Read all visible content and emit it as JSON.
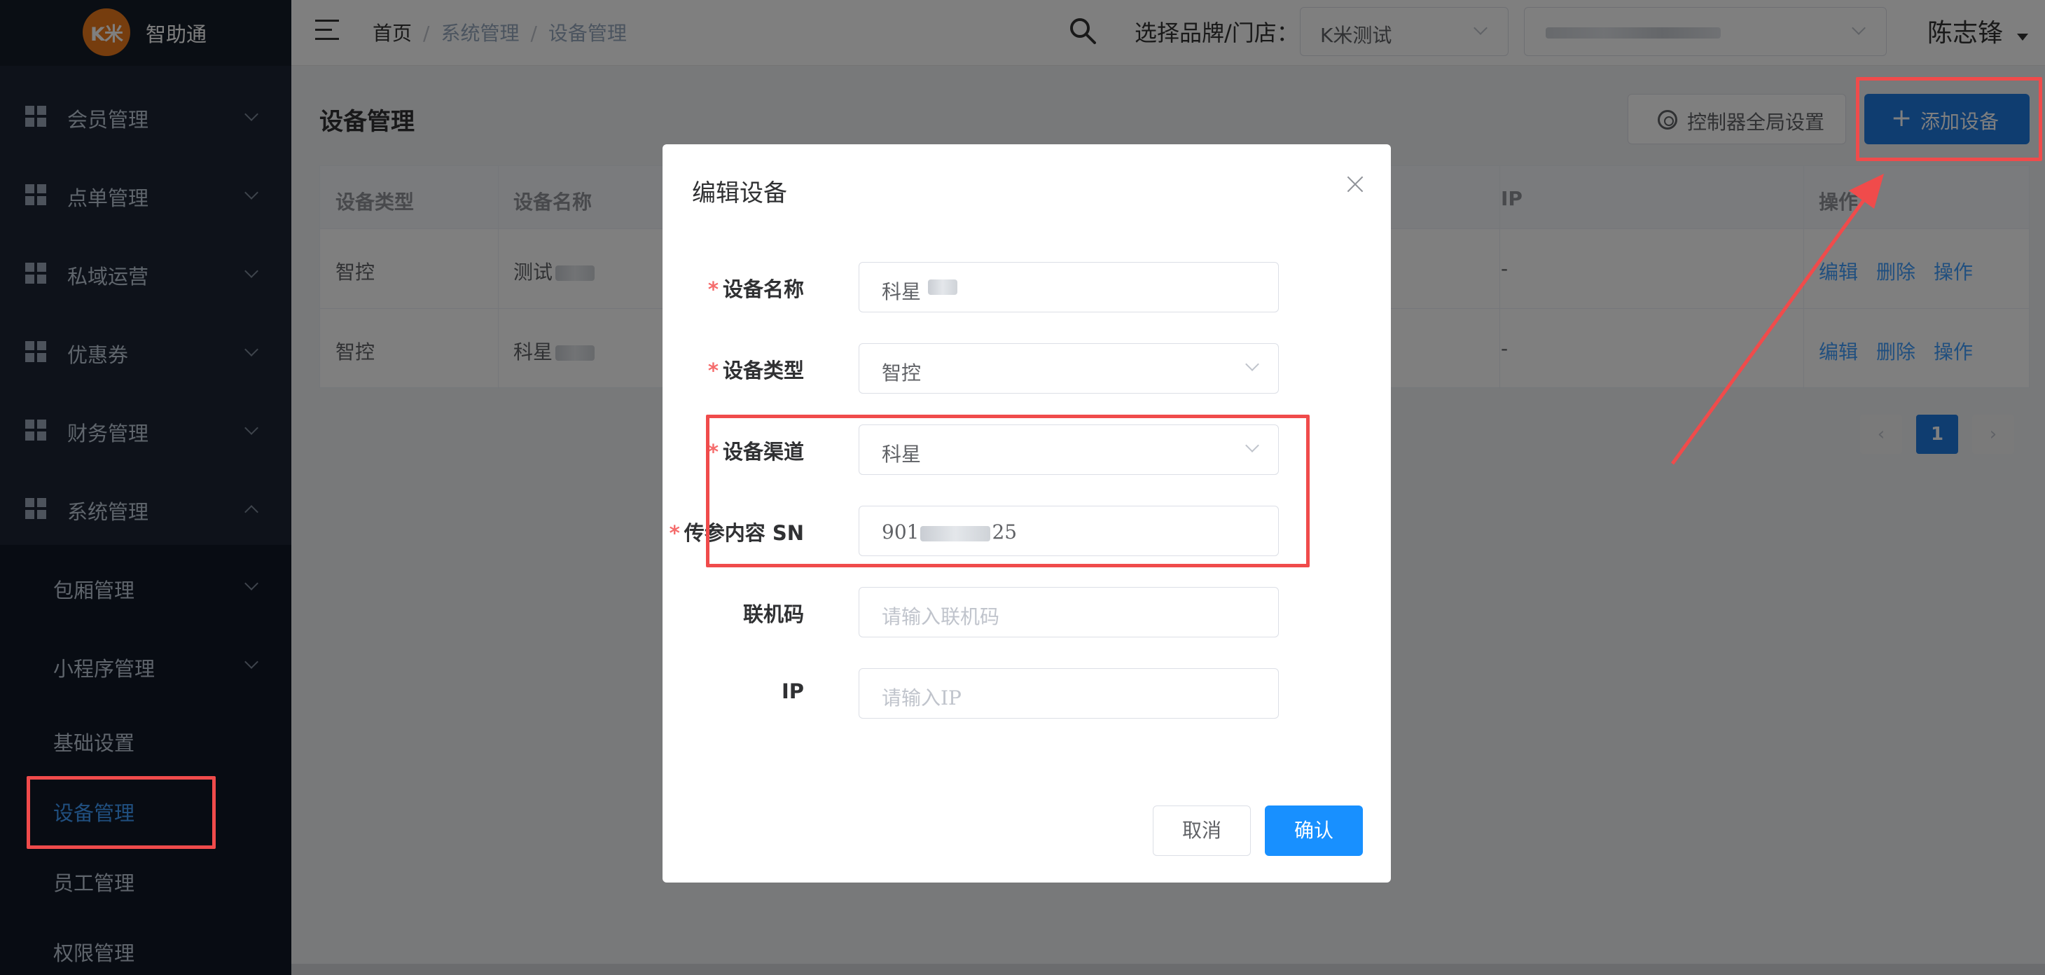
{
  "app": {
    "logo_text": "K米",
    "name": "智助通"
  },
  "sidebar": {
    "items": [
      {
        "label": "会员管理"
      },
      {
        "label": "点单管理"
      },
      {
        "label": "私域运营"
      },
      {
        "label": "优惠券"
      },
      {
        "label": "财务管理"
      },
      {
        "label": "系统管理"
      }
    ],
    "subitems": [
      {
        "label": "包厢管理"
      },
      {
        "label": "小程序管理"
      },
      {
        "label": "基础设置"
      },
      {
        "label": "设备管理"
      },
      {
        "label": "员工管理"
      },
      {
        "label": "权限管理"
      }
    ]
  },
  "header": {
    "breadcrumb": [
      "首页",
      "系统管理",
      "设备管理"
    ],
    "brand_label": "选择品牌/门店：",
    "brand_value": "K米测试",
    "user": "陈志锋"
  },
  "main": {
    "title": "设备管理",
    "global_settings_btn": "控制器全局设置",
    "add_btn": "添加设备",
    "table": {
      "headers": [
        "设备类型",
        "设备名称",
        "IP",
        "操作"
      ],
      "rows": [
        {
          "type": "智控",
          "name": "测试",
          "ip": "-",
          "actions": [
            "编辑",
            "删除",
            "操作"
          ]
        },
        {
          "type": "智控",
          "name": "科星",
          "ip": "-",
          "actions": [
            "编辑",
            "删除",
            "操作"
          ]
        }
      ]
    },
    "pagination": {
      "prev": "‹",
      "current": "1",
      "next": "›"
    }
  },
  "dialog": {
    "title": "编辑设备",
    "fields": [
      {
        "label": "设备名称",
        "required": "*",
        "value": "科星"
      },
      {
        "label": "设备类型",
        "required": "*",
        "value": "智控"
      },
      {
        "label": "设备渠道",
        "required": "*",
        "value": "科星"
      },
      {
        "label": "传参内容 SN",
        "required": "*",
        "value_start": "901",
        "value_end": "25"
      },
      {
        "label": "联机码",
        "placeholder": "请输入联机码"
      },
      {
        "label": "IP",
        "placeholder": "请输入IP"
      }
    ],
    "cancel": "取消",
    "confirm": "确认"
  },
  "colors": {
    "primary": "#1f7ae0",
    "danger_highlight": "#f04b4b",
    "sidebar_bg": "#1c2434"
  }
}
